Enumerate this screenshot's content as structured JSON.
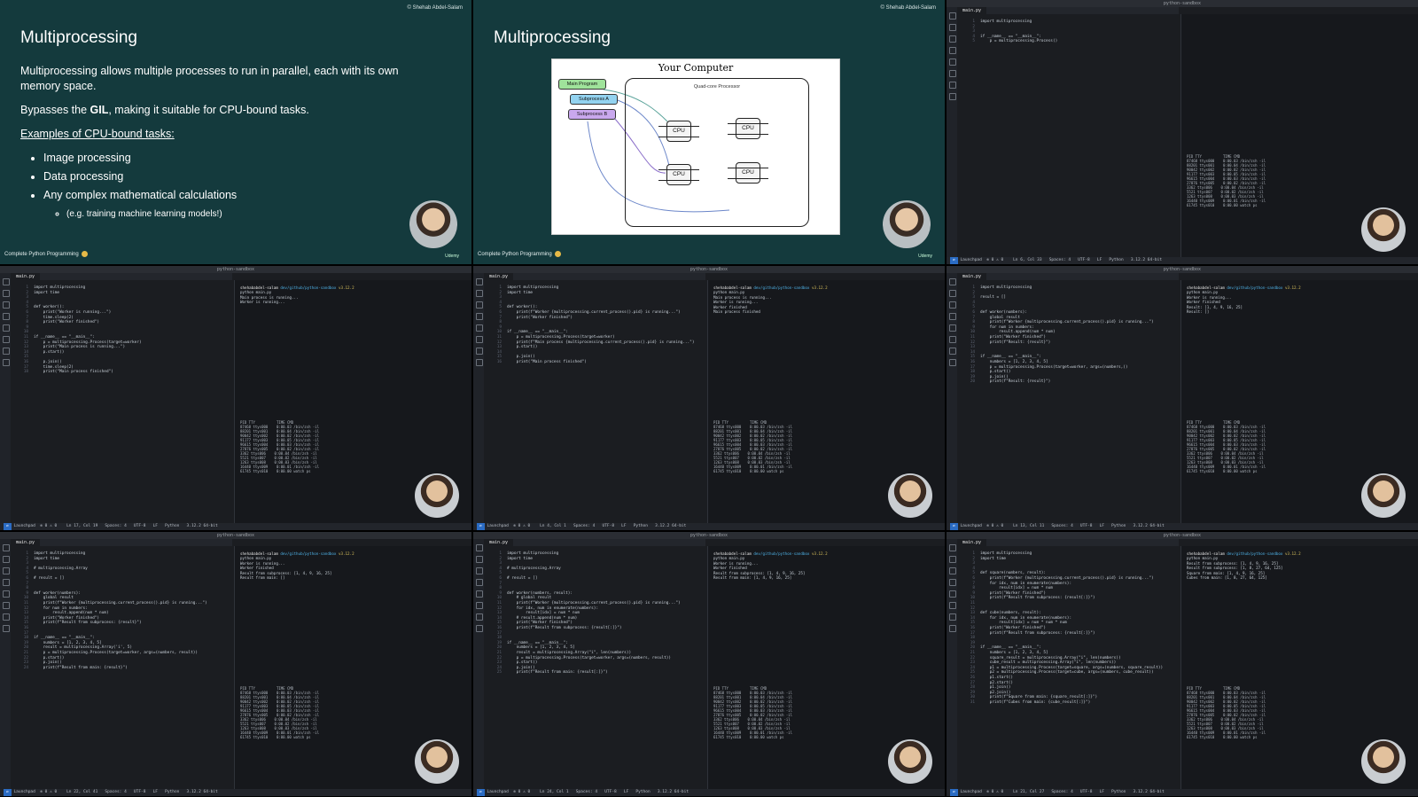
{
  "slide1": {
    "copyright": "© Shehab Abdel-Salam",
    "title": "Multiprocessing",
    "para1": "Multiprocessing allows multiple processes to run in parallel, each with its own memory space.",
    "para2_pre": "Bypasses the ",
    "para2_bold": "GIL",
    "para2_post": ", making it suitable for CPU-bound tasks.",
    "examples_heading": "Examples of CPU-bound tasks:",
    "bullets": [
      "Image processing",
      "Data processing",
      "Any complex mathematical calculations"
    ],
    "sub_bullet": "(e.g. training machine learning models!)",
    "footer": "Complete Python Programming",
    "udemy": "Udemy"
  },
  "slide2": {
    "copyright": "© Shehab Abdel-Salam",
    "title": "Multiprocessing",
    "diagram": {
      "title": "Your Computer",
      "quad_label": "Quad-core Processor",
      "main": "Main Program",
      "sub_a": "Subprocess A",
      "sub_b": "Subprocess B",
      "cpu": "CPU"
    },
    "footer": "Complete Python Programming",
    "udemy": "Udemy"
  },
  "ide_common": {
    "window_title": "python-sandbox",
    "tab": "main.py"
  },
  "ide2": {
    "code": [
      "import multiprocessing",
      "",
      "",
      "if __name__ == \"__main__\":",
      "    p = multiprocessing.Process()"
    ],
    "status": "Ln 6, Col 33   Spaces: 4   UTF-8   LF   Python   3.12.2 64-bit"
  },
  "ide3": {
    "code": [
      "import multiprocessing",
      "import time",
      "",
      "",
      "def worker():",
      "    print(\"Worker is running...\")",
      "    time.sleep(2)",
      "    print(\"Worker finished\")",
      "",
      "",
      "if __name__ == \"__main__\":",
      "    p = multiprocessing.Process(target=worker)",
      "    print(\"Main process is running...\")",
      "    p.start()",
      "",
      "    p.join()",
      "    time.sleep(2)",
      "    print(\"Main process finished\")"
    ],
    "terminal": [
      "python main.py",
      "Main process is running...",
      "Worker is running..."
    ],
    "status": "Ln 17, Col 19   Spaces: 4   UTF-8   LF   Python   3.12.2 64-bit"
  },
  "ide4": {
    "code": [
      "import multiprocessing",
      "import time",
      "",
      "",
      "def worker():",
      "    print(f\"Worker {multiprocessing.current_process().pid} is running...\")",
      "    print(\"Worker finished\")",
      "",
      "",
      "if __name__ == \"__main__\":",
      "    p = multiprocessing.Process(target=worker)",
      "    print(f\"Main process {multiprocessing.current_process().pid} is running...\")",
      "    p.start()",
      "",
      "    p.join()",
      "    print(\"Main process finished\")"
    ],
    "terminal": [
      "python main.py",
      "Main process is running...",
      "Worker is running...",
      "Worker finished",
      "Main process finished"
    ],
    "status": "Ln 4, Col 1   Spaces: 4   UTF-8   LF   Python   3.12.2 64-bit"
  },
  "ide5": {
    "code": [
      "import multiprocessing",
      "",
      "result = []",
      "",
      "",
      "def worker(numbers):",
      "    global result",
      "    print(f\"Worker {multiprocessing.current_process().pid} is running...\")",
      "    for num in numbers:",
      "        result.append(num * num)",
      "    print(\"Worker finished\")",
      "    print(f\"Result: {result}\")",
      "",
      "",
      "if __name__ == \"__main__\":",
      "    numbers = [1, 2, 3, 4, 5]",
      "    p = multiprocessing.Process(target=worker, args=(numbers,))",
      "    p.start()",
      "    p.join()",
      "    print(f\"Result: {result}\")"
    ],
    "terminal": [
      "python main.py",
      "Worker is running...",
      "Worker finished",
      "Result: [1, 4, 9, 16, 25]",
      "Result: []"
    ],
    "status": "Ln 13, Col 11   Spaces: 4   UTF-8   LF   Python   3.12.2 64-bit"
  },
  "ide6": {
    "code": [
      "import multiprocessing",
      "import time",
      "",
      "# multiprocessing.Array",
      "",
      "# result = []",
      "",
      "",
      "def worker(numbers):",
      "    global result",
      "    print(f\"Worker {multiprocessing.current_process().pid} is running...\")",
      "    for num in numbers:",
      "        result.append(num * num)",
      "    print(\"Worker finished\")",
      "    print(f\"Result from subprocess: {result}\")",
      "",
      "",
      "if __name__ == \"__main__\":",
      "    numbers = [1, 2, 3, 4, 5]",
      "    result = multiprocessing.Array('i', 5)",
      "    p = multiprocessing.Process(target=worker, args=(numbers, result))",
      "    p.start()",
      "    p.join()",
      "    print(f\"Result from main: {result}\")"
    ],
    "terminal": [
      "python main.py",
      "Worker is running...",
      "Worker finished",
      "Result from subprocess: [1, 4, 9, 16, 25]",
      "Result from main: []"
    ],
    "status": "Ln 22, Col 41   Spaces: 4   UTF-8   LF   Python   3.12.2 64-bit"
  },
  "ide7": {
    "code": [
      "import multiprocessing",
      "import time",
      "",
      "# multiprocessing.Array",
      "",
      "# result = []",
      "",
      "",
      "def worker(numbers, result):",
      "    # global result",
      "    print(f\"Worker {multiprocessing.current_process().pid} is running...\")",
      "    for idx, num in enumerate(numbers):",
      "        result[idx] = num * num",
      "    # result.append(num * num)",
      "    print(\"Worker finished\")",
      "    print(f\"Result from subprocess: {result[:]}\")",
      "",
      "",
      "if __name__ == \"__main__\":",
      "    numbers = [1, 2, 3, 4, 5]",
      "    result = multiprocessing.Array(\"i\", len(numbers))",
      "    p = multiprocessing.Process(target=worker, args=(numbers, result))",
      "    p.start()",
      "    p.join()",
      "    print(f\"Result from main: {result[:]}\")"
    ],
    "terminal": [
      "python main.py",
      "Worker is running...",
      "Worker finished",
      "Result from subprocess: [1, 4, 9, 16, 25]",
      "Result from main: [1, 4, 9, 16, 25]"
    ],
    "status": "Ln 24, Col 1   Spaces: 4   UTF-8   LF   Python   3.12.2 64-bit"
  },
  "ide8": {
    "code": [
      "import multiprocessing",
      "import time",
      "",
      "",
      "def square(numbers, result):",
      "    print(f\"Worker {multiprocessing.current_process().pid} is running...\")",
      "    for idx, num in enumerate(numbers):",
      "        result[idx] = num * num",
      "    print(\"Worker finished\")",
      "    print(f\"Result from subprocess: {result[:]}\")",
      "",
      "",
      "def cube(numbers, result):",
      "    for idx, num in enumerate(numbers):",
      "        result[idx] = num * num * num",
      "    print(\"Worker finished\")",
      "    print(f\"Result from subprocess: {result[:]}\")",
      "",
      "",
      "if __name__ == \"__main__\":",
      "    numbers = [1, 2, 3, 4, 5]",
      "    square_result = multiprocessing.Array(\"i\", len(numbers))",
      "    cube_result = multiprocessing.Array(\"i\", len(numbers))",
      "    p1 = multiprocessing.Process(target=square, args=(numbers, square_result))",
      "    p2 = multiprocessing.Process(target=cube, args=(numbers, cube_result))",
      "    p1.start()",
      "    p2.start()",
      "    p1.join()",
      "    p2.join()",
      "    print(f\"Square from main: {square_result[:]}\")",
      "    print(f\"Cubes from main: {cube_result[:]}\")"
    ],
    "terminal": [
      "python main.py",
      "Result from subprocess: [1, 4, 9, 16, 25]",
      "Result from subprocess: [1, 8, 27, 64, 125]",
      "Square from main: [1, 4, 9, 16, 25]",
      "Cubes from main: [1, 8, 27, 64, 125]"
    ],
    "status": "Ln 21, Col 27   Spaces: 4   UTF-8   LF   Python   3.12.2 64-bit"
  },
  "htop": {
    "header": "PID TTY          TIME CMD",
    "rows": [
      "87468 ttys000    0:00.03 /bin/zsh -il",
      "88201 ttys001    0:00.04 /bin/zsh -il",
      "90042 ttys002    0:00.02 /bin/zsh -il",
      "91177 ttys003    0:00.05 /bin/zsh -il",
      "96615 ttys004    0:00.03 /bin/zsh -il",
      "27876 ttys005    0:00.02 /bin/zsh -il",
      "3362 ttys006    0:00.04 /bin/zsh -il",
      "5521 ttys007    0:00.02 /bin/zsh -il",
      "1263 ttys008    0:00.03 /bin/zsh -il",
      "16440 ttys009    0:00.01 /bin/zsh -il",
      "61745 ttys010    0:00.00 watch ps"
    ],
    "prompt_user": "shehababdel-salam",
    "prompt_path": "dev/github/python-sandbox",
    "prompt_ver": "v3.12.2"
  },
  "statusbar_left": "Launchpad  ⊗ 0 ⚠ 0"
}
